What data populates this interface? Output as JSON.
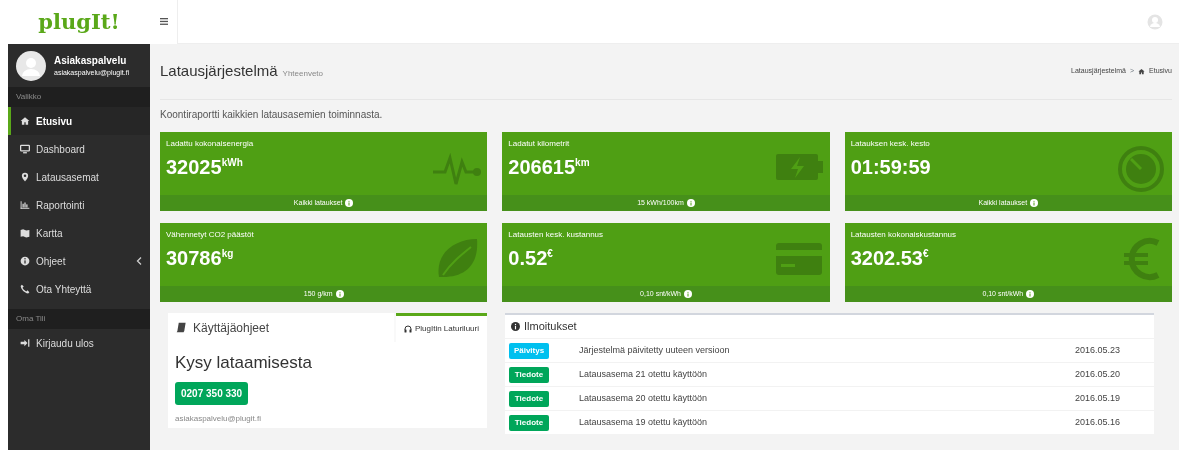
{
  "brand": "plugIt!",
  "user": {
    "name": "Asiakaspalvelu",
    "email": "asiakaspalvelu@plugit.fi"
  },
  "sidebar": {
    "sections": [
      {
        "title": "Valikko",
        "items": [
          {
            "label": "Etusivu",
            "selected": true,
            "kind": "link"
          },
          {
            "label": "Dashboard",
            "selected": false,
            "kind": "link"
          },
          {
            "label": "Latausasemat",
            "selected": false,
            "kind": "link"
          },
          {
            "label": "Raportointi",
            "selected": false,
            "kind": "link"
          },
          {
            "label": "Kartta",
            "selected": false,
            "kind": "link"
          },
          {
            "label": "Ohjeet",
            "selected": false,
            "kind": "submenu"
          },
          {
            "label": "Ota Yhteyttä",
            "selected": false,
            "kind": "link"
          }
        ]
      },
      {
        "title": "Oma Tili",
        "items": [
          {
            "label": "Kirjaudu ulos",
            "selected": false,
            "kind": "link"
          }
        ]
      }
    ]
  },
  "header": {
    "title": "Latausjärjestelmä",
    "subtitle": "Yhteenveto"
  },
  "breadcrumb": {
    "items": [
      "Latausjärjestelmä",
      "Etusivu"
    ],
    "separator": ">"
  },
  "description": "Koontiraportti kaikkien latausasemien toiminnasta.",
  "tiles": [
    {
      "title": "Ladattu kokonaisenergia",
      "value": "32025",
      "unit": "kWh",
      "footer": "Kaikki lataukset"
    },
    {
      "title": "Ladatut kilometrit",
      "value": "206615",
      "unit": "km",
      "footer": "15 kWh/100km"
    },
    {
      "title": "Latauksen kesk. kesto",
      "value": "01:59:59",
      "footer": "Kaikki lataukset"
    },
    {
      "title": "Vähennetyt CO2 päästöt",
      "value": "30786",
      "unit": "kg",
      "footer": "150 g/km"
    },
    {
      "title": "Latausten kesk. kustannus",
      "value": "0.52",
      "unit": "€",
      "footer": "0,10 snt/kWh"
    },
    {
      "title": "Latausten kokonaiskustannus",
      "value": "3202.53",
      "unit": "€",
      "footer": "0,10 snt/kWh"
    }
  ],
  "help": {
    "title": "Käyttäjäohjeet",
    "tabs": [
      {
        "label": "PlugItin Laturiluuri",
        "selected": true
      }
    ],
    "heading": "Kysy lataamisesta",
    "phone": "0207 350 330",
    "email": "asiakaspalvelu@plugit.fi"
  },
  "notices": {
    "title": "Ilmoitukset",
    "rows": [
      {
        "tag": "Päivitys",
        "color": "#00c0ef",
        "text": "Järjestelmä päivitetty uuteen versioon",
        "date": "2016.05.23"
      },
      {
        "tag": "Tiedote",
        "color": "#00a65a",
        "text": "Latausasema 21 otettu käyttöön",
        "date": "2016.05.20"
      },
      {
        "tag": "Tiedote",
        "color": "#00a65a",
        "text": "Latausasema 20 otettu käyttöön",
        "date": "2016.05.19"
      },
      {
        "tag": "Tiedote",
        "color": "#00a65a",
        "text": "Latausasema 19 otettu käyttöön",
        "date": "2016.05.16"
      }
    ]
  }
}
